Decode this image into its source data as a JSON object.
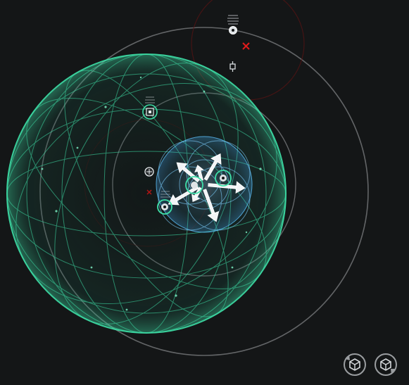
{
  "view": {
    "background": "#141617",
    "accent": "#3ee0a8",
    "ring_color": "#8a8c8e",
    "hostile_color": "#d01818"
  },
  "objects": [
    {
      "name": "object-bracket-ship-top",
      "icon": "ship-bracket-icon",
      "state": "neutral"
    },
    {
      "name": "object-bracket-celestial-top",
      "icon": "beacon-bracket-icon",
      "state": "neutral"
    },
    {
      "name": "object-bracket-ship-upper-left",
      "icon": "ship-bracket-icon",
      "state": "selected"
    },
    {
      "name": "object-bracket-ship-left",
      "icon": "ship-bracket-icon",
      "state": "neutral"
    },
    {
      "name": "object-bracket-ship-center",
      "icon": "ship-bracket-icon",
      "state": "selected"
    },
    {
      "name": "object-bracket-ship-right",
      "icon": "ship-bracket-icon",
      "state": "selected"
    },
    {
      "name": "object-bracket-ship-lower",
      "icon": "ship-bracket-icon",
      "state": "selected"
    }
  ],
  "controls": {
    "rotate_left_icon": "camera-rotate-left-icon",
    "rotate_right_icon": "camera-rotate-right-icon"
  }
}
